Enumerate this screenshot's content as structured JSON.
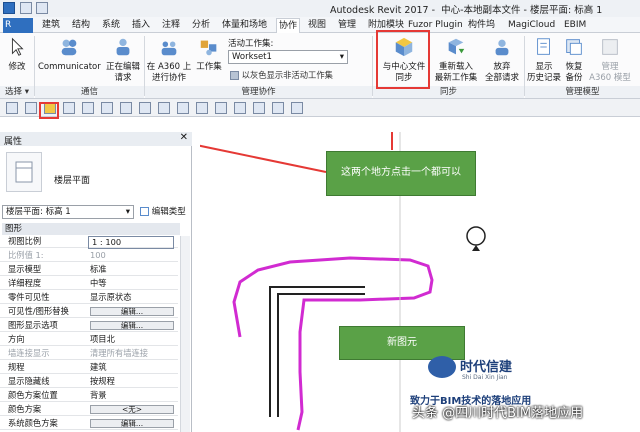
{
  "window": {
    "app_title": "Autodesk Revit 2017 -",
    "doc_title": "中心-本地副本文件 - 楼层平面: 标高 1"
  },
  "tabs": [
    "建筑",
    "结构",
    "系统",
    "插入",
    "注释",
    "分析",
    "体量和场地",
    "协作",
    "视图",
    "管理",
    "附加模块",
    "Fuzor Plugin",
    "构件坞",
    "MagiCloud",
    "EBIM"
  ],
  "active_tab": "协作",
  "ribbon": {
    "modify": "修改",
    "communicator": "Communicator",
    "editing_requests": [
      "正在编辑",
      "请求"
    ],
    "a360": [
      "在 A360 上",
      "进行协作"
    ],
    "worksets": "工作集",
    "active_workset_label": "活动工作集:",
    "active_workset_value": "Workset1",
    "gray_inactive": "以灰色显示非活动工作集",
    "sync": [
      "与中心文件",
      "同步"
    ],
    "reload": [
      "重新载入",
      "最新工作集"
    ],
    "relinquish": [
      "放弃",
      "全部请求"
    ],
    "history": [
      "显示",
      "历史记录"
    ],
    "restore": [
      "恢复",
      "备份"
    ],
    "a360mgmt": [
      "管理",
      "A360 模型"
    ],
    "panels": {
      "select": "选择 ▾",
      "comm": "通信",
      "collab": "管理协作",
      "sync": "同步",
      "model": "管理模型"
    }
  },
  "properties": {
    "title": "属性",
    "type_name": "楼层平面",
    "selector": "楼层平面: 标高 1",
    "edit_type": "编辑类型",
    "group": "图形",
    "rows": [
      {
        "label": "视图比例",
        "value": "1 : 100",
        "kind": "input"
      },
      {
        "label": "比例值 1:",
        "value": "100",
        "kind": "gray"
      },
      {
        "label": "显示模型",
        "value": "标准",
        "kind": "text"
      },
      {
        "label": "详细程度",
        "value": "中等",
        "kind": "text"
      },
      {
        "label": "零件可见性",
        "value": "显示原状态",
        "kind": "text"
      },
      {
        "label": "可见性/图形替换",
        "value": "编辑...",
        "kind": "button"
      },
      {
        "label": "图形显示选项",
        "value": "编辑...",
        "kind": "button"
      },
      {
        "label": "方向",
        "value": "项目北",
        "kind": "text"
      },
      {
        "label": "墙连接显示",
        "value": "清理所有墙连接",
        "kind": "gray"
      },
      {
        "label": "规程",
        "value": "建筑",
        "kind": "text"
      },
      {
        "label": "显示隐藏线",
        "value": "按规程",
        "kind": "text"
      },
      {
        "label": "颜色方案位置",
        "value": "背景",
        "kind": "text"
      },
      {
        "label": "颜色方案",
        "value": "<无>",
        "kind": "button"
      },
      {
        "label": "系统颜色方案",
        "value": "编辑...",
        "kind": "button"
      }
    ]
  },
  "canvas": {
    "callout_top": "这两个地方点击一个都可以",
    "callout_new": "新图元",
    "logo_cn": "时代信建",
    "logo_en": "Shi Dai Xin Jian",
    "slogan": "致力于BIM技术的落地应用",
    "watermark": "头条 @四川时代BIM落地应用"
  },
  "colors": {
    "accent_red": "#e53935",
    "callout_green": "#5aa147",
    "sketch_magenta": "#d12bd1"
  }
}
